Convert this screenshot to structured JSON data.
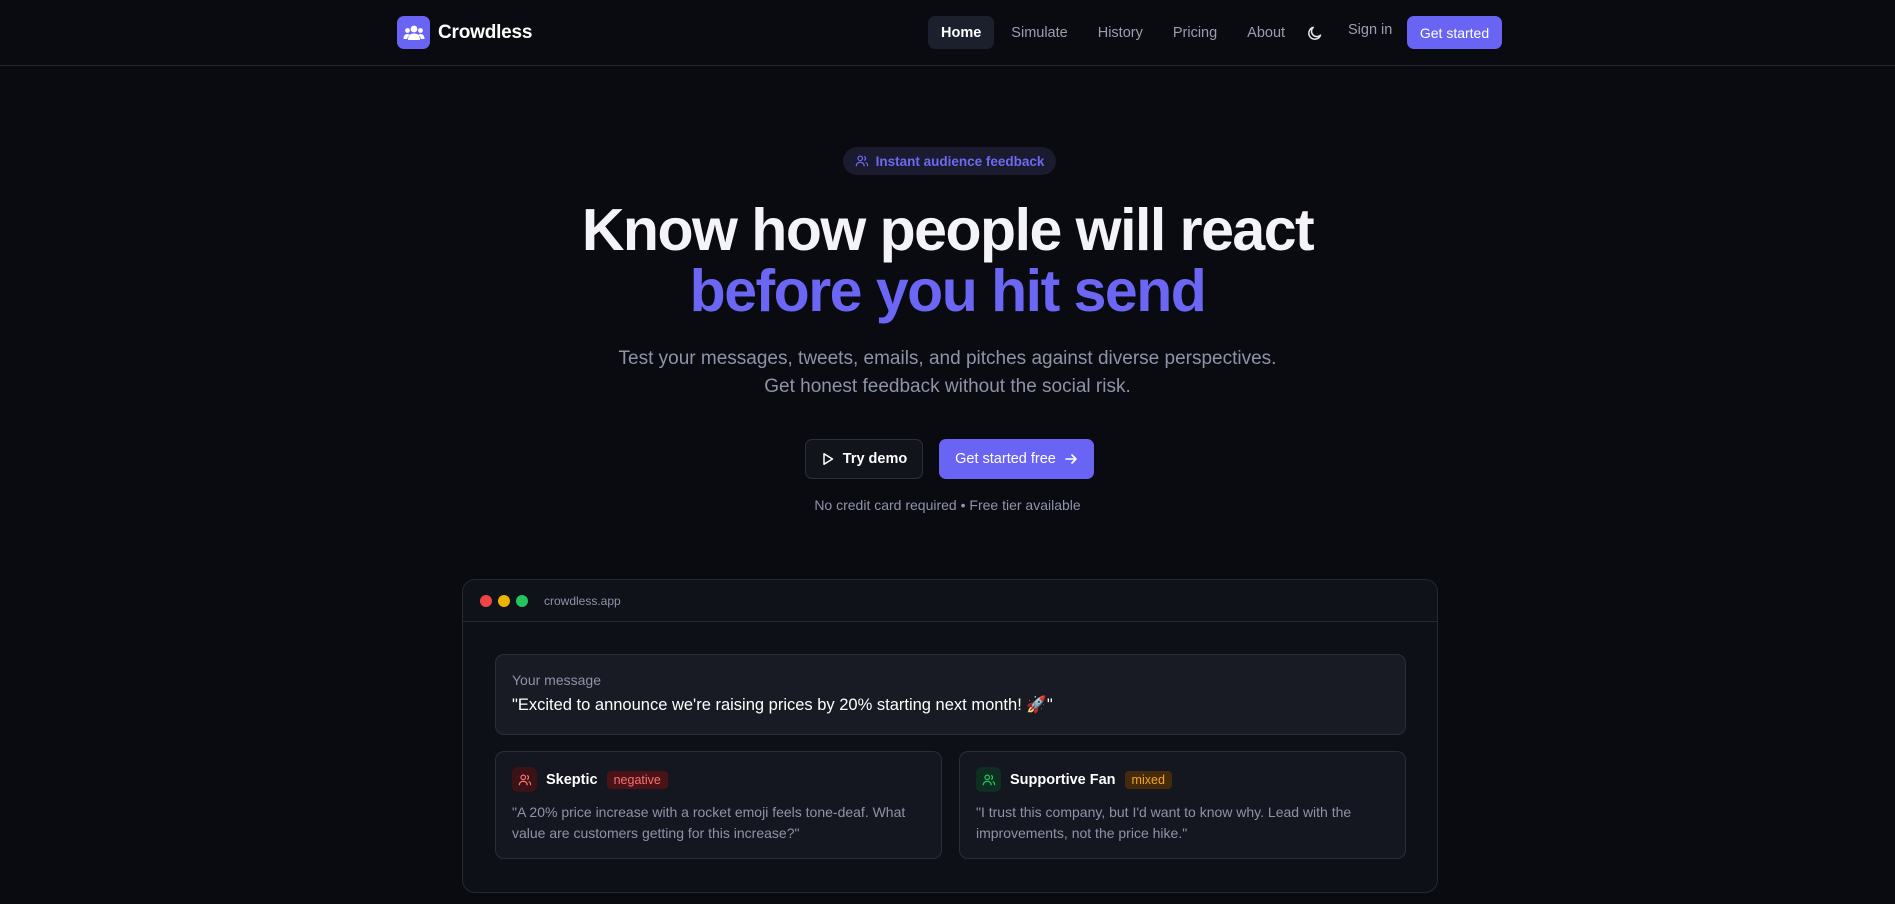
{
  "nav": {
    "brand": "Crowdless",
    "links": [
      {
        "label": "Home",
        "active": true
      },
      {
        "label": "Simulate",
        "active": false
      },
      {
        "label": "History",
        "active": false
      },
      {
        "label": "Pricing",
        "active": false
      },
      {
        "label": "About",
        "active": false
      }
    ],
    "theme_icon": "moon-icon",
    "sign_in": "Sign in",
    "cta": "Get started"
  },
  "hero": {
    "badge": "Instant audience feedback",
    "headline_line1": "Know how people will react",
    "headline_line2": "before you hit send",
    "subtitle_line1": "Test your messages, tweets, emails, and pitches against diverse perspectives.",
    "subtitle_line2": "Get honest feedback without the social risk.",
    "demo_button": "Try demo",
    "start_button": "Get started free",
    "note": "No credit card required • Free tier available"
  },
  "demo": {
    "url": "crowdless.app",
    "message_label": "Your message",
    "message_text": "\"Excited to announce we're raising prices by 20% starting next month! 🚀\"",
    "personas": [
      {
        "name": "Skeptic",
        "sentiment": "negative",
        "quote": "\"A 20% price increase with a rocket emoji feels tone-deaf. What value are customers getting for this increase?\""
      },
      {
        "name": "Supportive Fan",
        "sentiment": "mixed",
        "quote": "\"I trust this company, but I'd want to know why. Lead with the improvements, not the price hike.\""
      }
    ]
  },
  "colors": {
    "background": "#0a0b10",
    "accent": "#6a64f5",
    "negative": "#f87171",
    "mixed": "#f5a623",
    "positive": "#22c55e"
  }
}
